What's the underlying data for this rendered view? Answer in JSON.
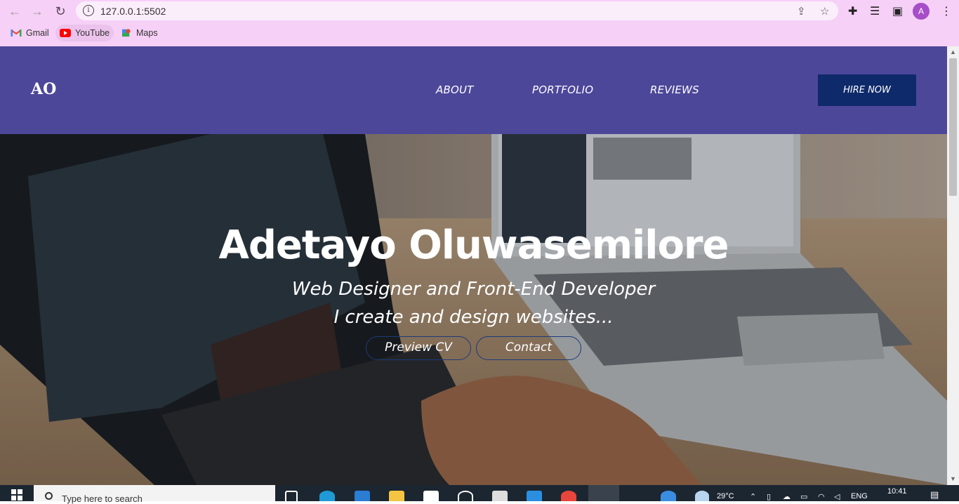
{
  "browser": {
    "url": "127.0.0.1:5502",
    "profile_initial": "A",
    "bookmarks": [
      {
        "label": "Gmail",
        "icon": "gmail-icon"
      },
      {
        "label": "YouTube",
        "icon": "youtube-icon"
      },
      {
        "label": "Maps",
        "icon": "maps-icon"
      }
    ]
  },
  "site": {
    "logo": "AO",
    "nav": [
      "ABOUT",
      "PORTFOLIO",
      "REVIEWS"
    ],
    "hire_label": "HIRE NOW",
    "colors": {
      "nav_bg": "#4d479a",
      "hire_bg": "#0e2a6b"
    }
  },
  "hero": {
    "title": "Adetayo Oluwasemilore",
    "subtitle_1": "Web Designer and Front-End Developer",
    "subtitle_2": "I create and design websites...",
    "btn_cv": "Preview CV",
    "btn_contact": "Contact"
  },
  "taskbar": {
    "search_placeholder": "Type here to search",
    "temperature": "29°C",
    "language": "ENG",
    "time": "10:41"
  }
}
